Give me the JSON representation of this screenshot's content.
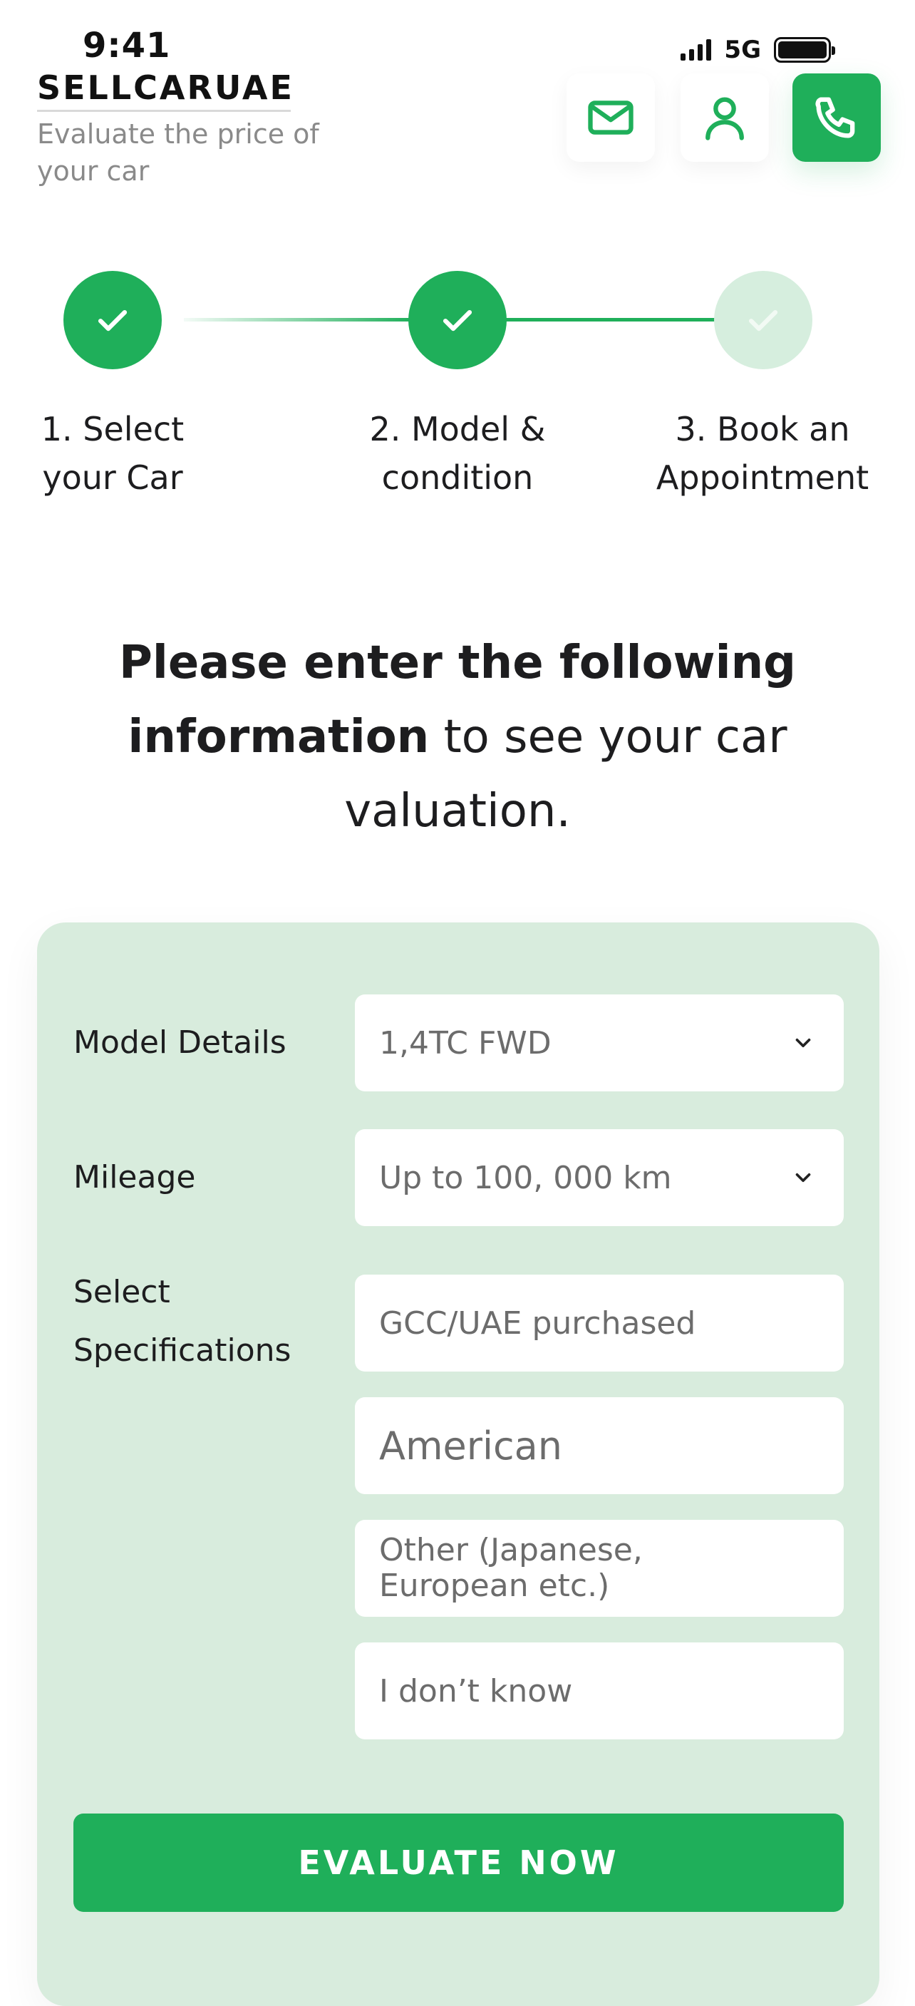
{
  "status_bar": {
    "time": "9:41",
    "network": "5G"
  },
  "header": {
    "brand": "SELLCARUAE",
    "tagline": "Evaluate the price of your car",
    "icons": [
      "mail-icon",
      "user-icon",
      "phone-icon"
    ],
    "accent_color": "#1faf5a"
  },
  "stepper": {
    "steps": [
      {
        "line1": "1. Select",
        "line2": "your Car",
        "state": "complete"
      },
      {
        "line1": "2. Model &",
        "line2": "condition",
        "state": "complete"
      },
      {
        "line1": "3. Book an",
        "line2": "Appointment",
        "state": "pending"
      }
    ]
  },
  "heading": {
    "bold": "Please enter the following information",
    "rest": " to see your car valuation."
  },
  "form": {
    "model_details": {
      "label": "Model Details",
      "value": "1,4TC FWD"
    },
    "mileage": {
      "label": "Mileage",
      "value": "Up to 100, 000 km"
    },
    "specifications": {
      "label_line1": "Select",
      "label_line2": "Specifications",
      "options": [
        "GCC/UAE purchased",
        "American",
        "Other (Japanese, European etc.)",
        "I don’t know"
      ]
    },
    "submit_label": "EVALUATE NOW",
    "card_color": "#d8ecdd"
  }
}
